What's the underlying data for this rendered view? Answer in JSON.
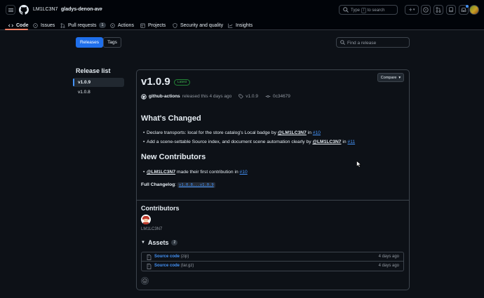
{
  "header": {
    "owner": "LM1LC3N7",
    "separator": "/",
    "repo": "gladys-denon-avr",
    "search": {
      "prefix": "Type",
      "key": "/",
      "suffix": "to search"
    }
  },
  "nav": {
    "tabs": [
      {
        "label": "Code",
        "active": true
      },
      {
        "label": "Issues"
      },
      {
        "label": "Pull requests",
        "count": "1"
      },
      {
        "label": "Actions"
      },
      {
        "label": "Projects"
      },
      {
        "label": "Security and quality"
      },
      {
        "label": "Insights"
      }
    ]
  },
  "subnav": {
    "releases_label": "Releases",
    "tags_label": "Tags",
    "find_placeholder": "Find a release"
  },
  "release_list": {
    "title": "Release list",
    "items": [
      "v1.0.9",
      "v1.0.8"
    ]
  },
  "release": {
    "version": "v1.0.9",
    "badge": "Latest",
    "compare_label": "Compare",
    "author": "github-actions",
    "released_text": "released this 4 days ago",
    "tag": "v1.0.9",
    "commit": "0c34679",
    "whats_changed_title": "What's Changed",
    "changes": [
      {
        "text": "Declare transports: local for the store catalog's Local badge by",
        "mention": "@LM1LC3N7",
        "in": "in",
        "pr": "#10"
      },
      {
        "text": "Add a scene-settable Source index, and document scene automation clearly by",
        "mention": "@LM1LC3N7",
        "in": "in",
        "pr": "#11"
      }
    ],
    "new_contributors_title": "New Contributors",
    "new_contributors": [
      {
        "mention": "@LM1LC3N7",
        "text": "made their first contribution in",
        "pr": "#10"
      }
    ],
    "full_changelog_label": "Full Changelog",
    "full_changelog_sep": ":",
    "full_changelog_range": "v1.0.8...v1.0.9"
  },
  "contributors": {
    "title": "Contributors",
    "names": [
      "LM1LC3N7"
    ]
  },
  "assets": {
    "title": "Assets",
    "count": "2",
    "items": [
      {
        "name": "Source code",
        "ext": "(zip)",
        "date": "4 days ago"
      },
      {
        "name": "Source code",
        "ext": "(tar.gz)",
        "date": "4 days ago"
      }
    ]
  },
  "colors": {
    "background": "#0d1117",
    "header_bg": "#010409",
    "border": "#3d444d",
    "accent_blue": "#4493f8",
    "primary_button": "#1f6feb",
    "latest_green": "#3fb950",
    "nav_underline": "#f78166"
  },
  "icons": [
    "hamburger-icon",
    "github-logo-icon",
    "search-icon",
    "plus-icon",
    "issues-icon",
    "pull-request-icon",
    "inbox-icon",
    "code-icon",
    "play-icon",
    "table-icon",
    "shield-icon",
    "graph-icon",
    "tag-icon",
    "commit-icon",
    "zip-icon",
    "smiley-icon",
    "triangle-down-icon"
  ]
}
